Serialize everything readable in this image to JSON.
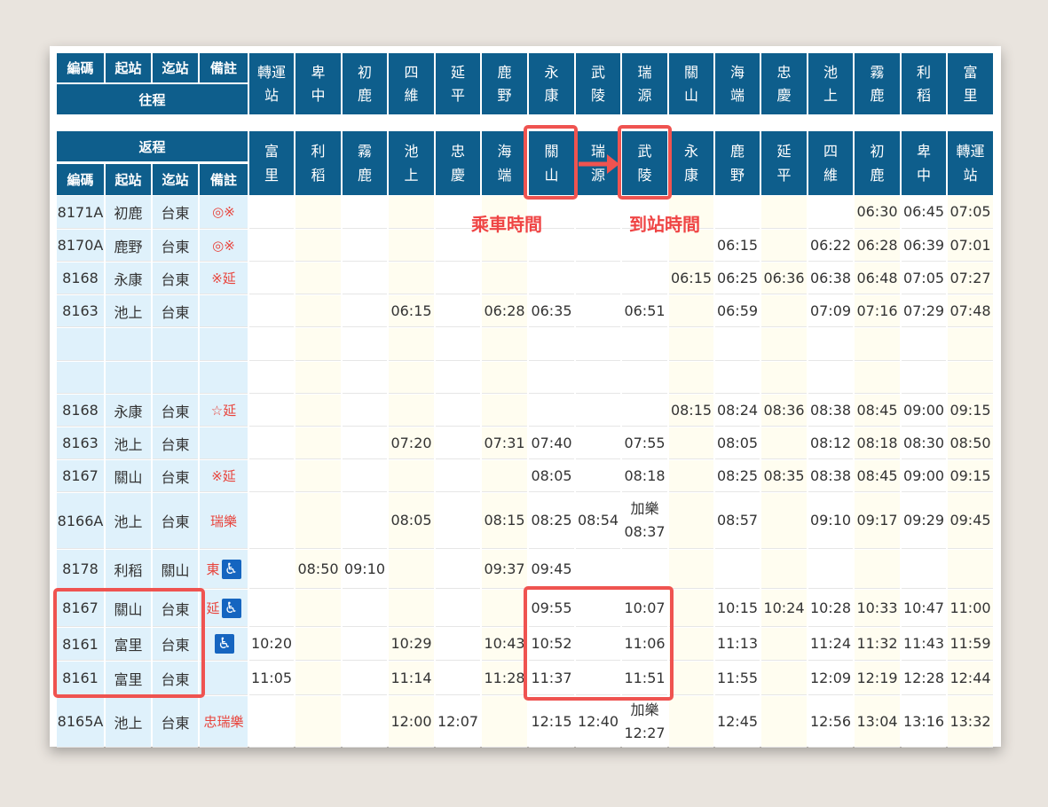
{
  "top_header": {
    "labels": [
      "編碼",
      "起站",
      "迄站",
      "備註"
    ],
    "direction": "往程",
    "stations": [
      "轉運站",
      "卑中",
      "初鹿",
      "四維",
      "延平",
      "鹿野",
      "永康",
      "武陵",
      "瑞源",
      "關山",
      "海端",
      "忠慶",
      "池上",
      "霧鹿",
      "利稻",
      "富里"
    ]
  },
  "return_header": {
    "direction": "返程",
    "labels": [
      "編碼",
      "起站",
      "迄站",
      "備註"
    ],
    "stations": [
      "富里",
      "利稻",
      "霧鹿",
      "池上",
      "忠慶",
      "海端",
      "關山",
      "瑞源",
      "武陵",
      "永康",
      "鹿野",
      "延平",
      "四維",
      "初鹿",
      "卑中",
      "轉運站"
    ]
  },
  "annotations": {
    "boarding": "乘車時間",
    "arrival": "到站時間"
  },
  "rows": [
    {
      "code": "8171A",
      "from": "初鹿",
      "to": "台東",
      "note": "◎※",
      "times": [
        "",
        "",
        "",
        "",
        "",
        "",
        "",
        "",
        "",
        "",
        "",
        "",
        "",
        "06:30",
        "06:45",
        "07:05"
      ]
    },
    {
      "code": "8170A",
      "from": "鹿野",
      "to": "台東",
      "note": "◎※",
      "times": [
        "",
        "",
        "",
        "",
        "",
        "",
        "",
        "",
        "",
        "",
        "06:15",
        "",
        "06:22",
        "06:28",
        "06:39",
        "07:01"
      ]
    },
    {
      "code": "8168",
      "from": "永康",
      "to": "台東",
      "note": "※延",
      "times": [
        "",
        "",
        "",
        "",
        "",
        "",
        "",
        "",
        "",
        "06:15",
        "06:25",
        "06:36",
        "06:38",
        "06:48",
        "07:05",
        "07:27"
      ]
    },
    {
      "code": "8163",
      "from": "池上",
      "to": "台東",
      "note": "",
      "times": [
        "",
        "",
        "",
        "06:15",
        "",
        "06:28",
        "06:35",
        "",
        "06:51",
        "",
        "06:59",
        "",
        "07:09",
        "07:16",
        "07:29",
        "07:48"
      ]
    },
    {
      "code": "",
      "from": "",
      "to": "",
      "note": "",
      "times": [
        "",
        "",
        "",
        "",
        "",
        "",
        "",
        "",
        "",
        "",
        "",
        "",
        "",
        "",
        "",
        ""
      ]
    },
    {
      "code": "",
      "from": "",
      "to": "",
      "note": "",
      "times": [
        "",
        "",
        "",
        "",
        "",
        "",
        "",
        "",
        "",
        "",
        "",
        "",
        "",
        "",
        "",
        ""
      ]
    },
    {
      "code": "8168",
      "from": "永康",
      "to": "台東",
      "note": "☆延",
      "times": [
        "",
        "",
        "",
        "",
        "",
        "",
        "",
        "",
        "",
        "08:15",
        "08:24",
        "08:36",
        "08:38",
        "08:45",
        "09:00",
        "09:15"
      ]
    },
    {
      "code": "8163",
      "from": "池上",
      "to": "台東",
      "note": "",
      "times": [
        "",
        "",
        "",
        "07:20",
        "",
        "07:31",
        "07:40",
        "",
        "07:55",
        "",
        "08:05",
        "",
        "08:12",
        "08:18",
        "08:30",
        "08:50"
      ]
    },
    {
      "code": "8167",
      "from": "關山",
      "to": "台東",
      "note": "※延",
      "times": [
        "",
        "",
        "",
        "",
        "",
        "",
        "08:05",
        "",
        "08:18",
        "",
        "08:25",
        "08:35",
        "08:38",
        "08:45",
        "09:00",
        "09:15"
      ]
    },
    {
      "code": "8166A",
      "from": "池上",
      "to": "台東",
      "note": "瑞樂",
      "times": [
        "",
        "",
        "",
        "08:05",
        "",
        "08:15",
        "08:25",
        "08:54",
        "加樂\n08:37",
        "",
        "08:57",
        "",
        "09:10",
        "09:17",
        "09:29",
        "09:45"
      ]
    },
    {
      "code": "8178",
      "from": "利稻",
      "to": "關山",
      "note": "東",
      "wheelchair": true,
      "times": [
        "",
        "08:50",
        "09:10",
        "",
        "",
        "09:37",
        "09:45",
        "",
        "",
        "",
        "",
        "",
        "",
        "",
        "",
        ""
      ]
    },
    {
      "code": "8167",
      "from": "關山",
      "to": "台東",
      "note": "延",
      "wheelchair": true,
      "times": [
        "",
        "",
        "",
        "",
        "",
        "",
        "09:55",
        "",
        "10:07",
        "",
        "10:15",
        "10:24",
        "10:28",
        "10:33",
        "10:47",
        "11:00"
      ]
    },
    {
      "code": "8161",
      "from": "富里",
      "to": "台東",
      "note": "",
      "wheelchair": true,
      "times": [
        "10:20",
        "",
        "",
        "10:29",
        "",
        "10:43",
        "10:52",
        "",
        "11:06",
        "",
        "11:13",
        "",
        "11:24",
        "11:32",
        "11:43",
        "11:59"
      ]
    },
    {
      "code": "8161",
      "from": "富里",
      "to": "台東",
      "note": "",
      "times": [
        "11:05",
        "",
        "",
        "11:14",
        "",
        "11:28",
        "11:37",
        "",
        "11:51",
        "",
        "11:55",
        "",
        "12:09",
        "12:19",
        "12:28",
        "12:44"
      ]
    },
    {
      "code": "8165A",
      "from": "池上",
      "to": "台東",
      "note": "忠瑞樂",
      "times": [
        "",
        "",
        "",
        "12:00",
        "12:07",
        "",
        "12:15",
        "12:40",
        "加樂\n12:27",
        "",
        "12:45",
        "",
        "12:56",
        "13:04",
        "13:16",
        "13:32"
      ]
    }
  ]
}
